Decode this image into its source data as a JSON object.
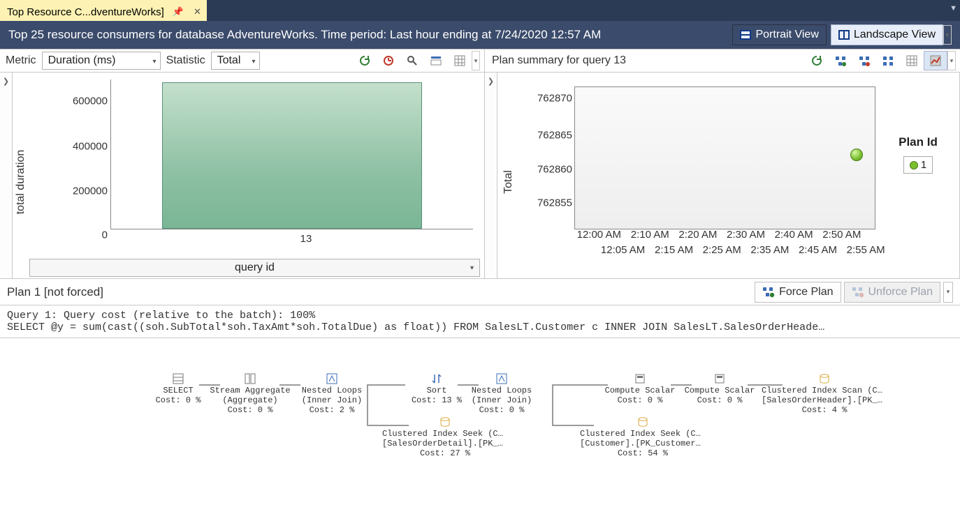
{
  "tab": {
    "title": "Top Resource C...dventureWorks]"
  },
  "title": "Top 25 resource consumers for database AdventureWorks. Time period: Last hour ending at 7/24/2020 12:57 AM",
  "views": {
    "portrait": "Portrait View",
    "landscape": "Landscape View"
  },
  "left_toolbar": {
    "metric_label": "Metric",
    "metric_value": "Duration (ms)",
    "stat_label": "Statistic",
    "stat_value": "Total"
  },
  "right_header": "Plan summary for query 13",
  "chart_data": [
    {
      "type": "bar",
      "title": "",
      "xlabel": "query id",
      "ylabel": "total duration",
      "categories": [
        "13"
      ],
      "values": [
        762870
      ],
      "yticks": [
        0,
        200000,
        400000,
        600000
      ],
      "ylim": [
        0,
        780000
      ]
    },
    {
      "type": "scatter",
      "title": "",
      "xlabel": "",
      "ylabel": "Total",
      "series": [
        {
          "name": "1",
          "x": [
            "2:53 AM"
          ],
          "y": [
            762860
          ]
        }
      ],
      "xticks_row1": [
        "12:00 AM",
        "2:10 AM",
        "2:20 AM",
        "2:30 AM",
        "2:40 AM",
        "2:50 AM"
      ],
      "xticks_row2": [
        "12:05 AM",
        "2:15 AM",
        "2:25 AM",
        "2:35 AM",
        "2:45 AM",
        "2:55 AM"
      ],
      "yticks": [
        762855,
        762860,
        762865,
        762870
      ],
      "ylim": [
        762852,
        762872
      ],
      "legend_title": "Plan Id"
    }
  ],
  "plan_header": {
    "title": "Plan 1 [not forced]",
    "force": "Force Plan",
    "unforce": "Unforce Plan"
  },
  "query_text": "Query 1: Query cost (relative to the batch): 100%\nSELECT @y = sum(cast((soh.SubTotal*soh.TaxAmt*soh.TotalDue) as float)) FROM SalesLT.Customer c INNER JOIN SalesLT.SalesOrderHeade…",
  "operators": {
    "select": {
      "l1": "SELECT",
      "l2": "Cost: 0 %"
    },
    "streamagg": {
      "l1": "Stream Aggregate",
      "l2": "(Aggregate)",
      "l3": "Cost: 0 %"
    },
    "nl1": {
      "l1": "Nested Loops",
      "l2": "(Inner Join)",
      "l3": "Cost: 2 %"
    },
    "sort": {
      "l1": "Sort",
      "l2": "Cost: 13 %"
    },
    "cis1": {
      "l1": "Clustered Index Seek (Cluste…",
      "l2": "[SalesOrderDetail].[PK_Sales…",
      "l3": "Cost: 27 %"
    },
    "nl2": {
      "l1": "Nested Loops",
      "l2": "(Inner Join)",
      "l3": "Cost: 0 %"
    },
    "cs1": {
      "l1": "Compute Scalar",
      "l2": "Cost: 0 %"
    },
    "cis2": {
      "l1": "Clustered Index Seek (Cluste…",
      "l2": "[Customer].[PK_Customer_Cust…",
      "l3": "Cost: 54 %"
    },
    "cs2": {
      "l1": "Compute Scalar",
      "l2": "Cost: 0 %"
    },
    "ciscan": {
      "l1": "Clustered Index Scan (Cluste…",
      "l2": "[SalesOrderHeader].[PK_Sales…",
      "l3": "Cost: 4 %"
    }
  }
}
